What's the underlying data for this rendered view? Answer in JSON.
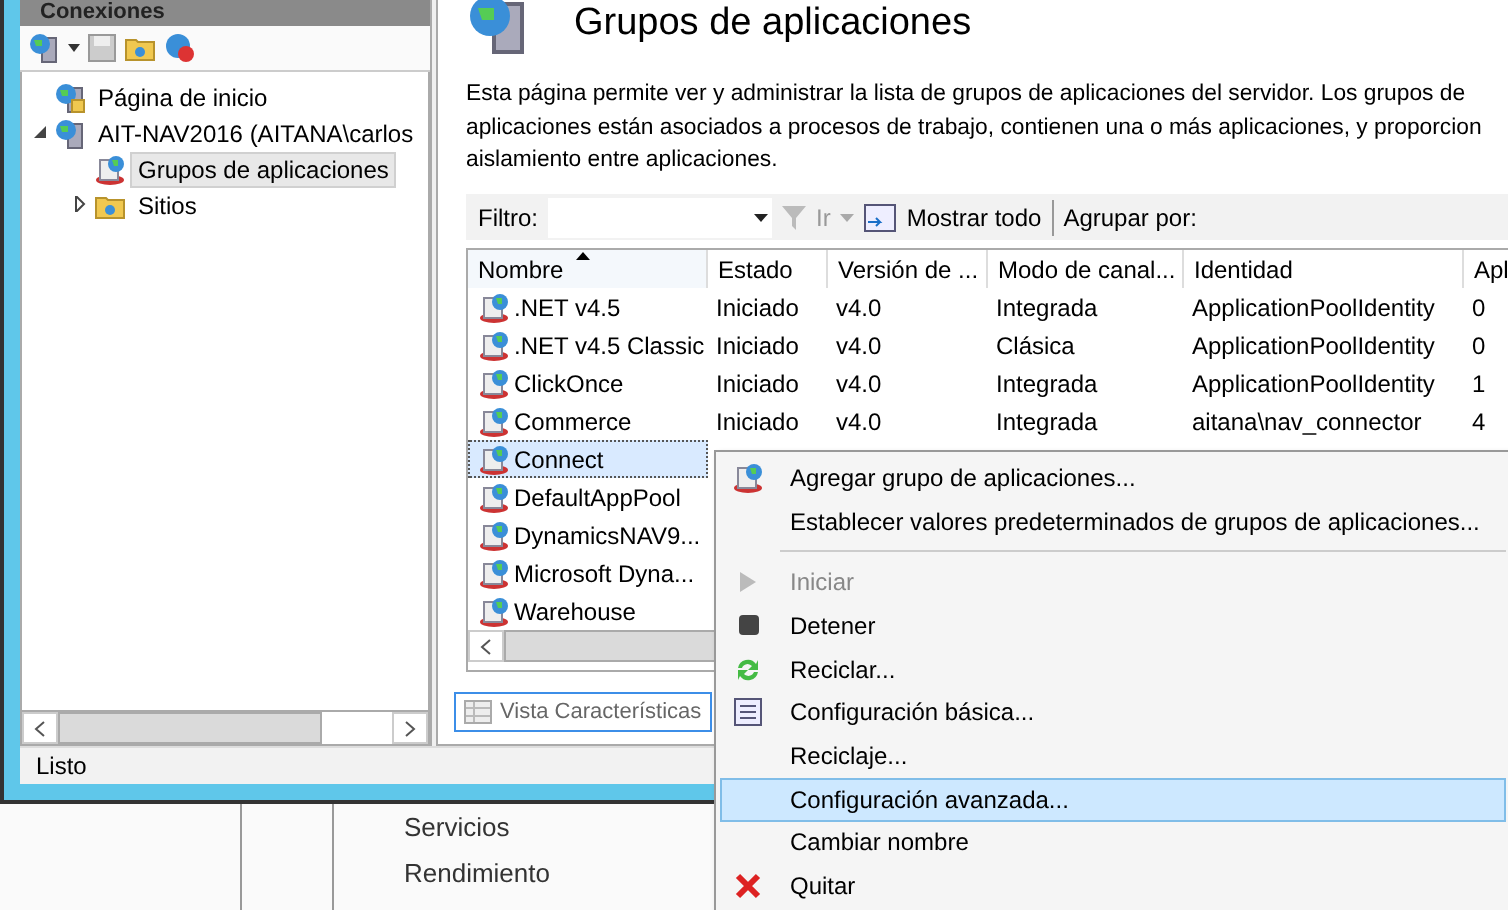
{
  "connections": {
    "title": "Conexiones",
    "tree": [
      {
        "label": "Página de inicio",
        "kind": "home",
        "selected": false
      },
      {
        "label": "AIT-NAV2016 (AITANA\\carlos",
        "kind": "server",
        "selected": false,
        "expanded": true,
        "children": [
          {
            "label": "Grupos de aplicaciones",
            "kind": "pools",
            "selected": true
          },
          {
            "label": "Sitios",
            "kind": "sites",
            "selected": false,
            "expanded": false
          }
        ]
      }
    ]
  },
  "page": {
    "title": "Grupos de aplicaciones",
    "description": "Esta página permite ver y administrar la lista de grupos de aplicaciones del servidor. Los grupos de aplicaciones están asociados a procesos de trabajo, contienen una o más aplicaciones, y proporcion aislamiento entre aplicaciones.",
    "filter": {
      "label": "Filtro:",
      "go": "Ir",
      "show_all": "Mostrar todo",
      "group_by": "Agrupar por:"
    },
    "table": {
      "columns": [
        {
          "label": "Nombre",
          "sorted": true
        },
        {
          "label": "Estado",
          "sorted": false
        },
        {
          "label": "Versión de ...",
          "sorted": false
        },
        {
          "label": "Modo de canal...",
          "sorted": false
        },
        {
          "label": "Identidad",
          "sorted": false
        },
        {
          "label": "Apl",
          "sorted": false
        }
      ],
      "rows": [
        {
          "cells": [
            ".NET v4.5",
            "Iniciado",
            "v4.0",
            "Integrada",
            "ApplicationPoolIdentity",
            "0"
          ],
          "selected": false
        },
        {
          "cells": [
            ".NET v4.5 Classic",
            "Iniciado",
            "v4.0",
            "Clásica",
            "ApplicationPoolIdentity",
            "0"
          ],
          "selected": false
        },
        {
          "cells": [
            "ClickOnce",
            "Iniciado",
            "v4.0",
            "Integrada",
            "ApplicationPoolIdentity",
            "1"
          ],
          "selected": false
        },
        {
          "cells": [
            "Commerce",
            "Iniciado",
            "v4.0",
            "Integrada",
            "aitana\\nav_connector",
            "4"
          ],
          "selected": false
        },
        {
          "cells": [
            "Connect"
          ],
          "selected": true
        },
        {
          "cells": [
            "DefaultAppPool"
          ],
          "selected": false
        },
        {
          "cells": [
            "DynamicsNAV9..."
          ],
          "selected": false
        },
        {
          "cells": [
            "Microsoft Dyna..."
          ],
          "selected": false
        },
        {
          "cells": [
            "Warehouse"
          ],
          "selected": false
        }
      ]
    },
    "view_button": "Vista Características"
  },
  "status_bar": "Listo",
  "background_window": {
    "items": [
      "Servicios",
      "Rendimiento"
    ]
  },
  "context_menu": [
    {
      "kind": "item",
      "label": "Agregar grupo de aplicaciones...",
      "disabled": false,
      "selected": false
    },
    {
      "kind": "item",
      "label": "Establecer valores predeterminados de grupos de aplicaciones...",
      "disabled": false,
      "selected": false
    },
    {
      "kind": "separator"
    },
    {
      "kind": "item",
      "label": "Iniciar",
      "disabled": true,
      "selected": false
    },
    {
      "kind": "item",
      "label": "Detener",
      "disabled": false,
      "selected": false
    },
    {
      "kind": "item",
      "label": "Reciclar...",
      "disabled": false,
      "selected": false
    },
    {
      "kind": "item",
      "label": "Configuración básica...",
      "disabled": false,
      "selected": false
    },
    {
      "kind": "item",
      "label": "Reciclaje...",
      "disabled": false,
      "selected": false
    },
    {
      "kind": "item",
      "label": "Configuración avanzada...",
      "disabled": false,
      "selected": true
    },
    {
      "kind": "item",
      "label": "Cambiar nombre",
      "disabled": false,
      "selected": false
    },
    {
      "kind": "item",
      "label": "Quitar",
      "disabled": false,
      "selected": false
    }
  ]
}
